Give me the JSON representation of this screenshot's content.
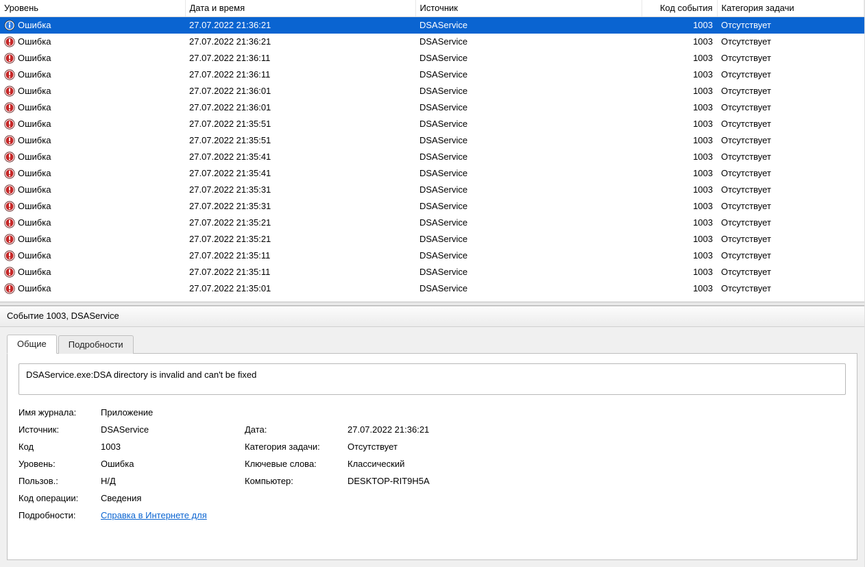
{
  "columns": {
    "level": "Уровень",
    "datetime": "Дата и время",
    "source": "Источник",
    "event_id": "Код события",
    "task_category": "Категория задачи"
  },
  "events": [
    {
      "level": "Ошибка",
      "selected": true,
      "icon": "info",
      "datetime": "27.07.2022 21:36:21",
      "source": "DSAService",
      "id": "1003",
      "category": "Отсутствует"
    },
    {
      "level": "Ошибка",
      "selected": false,
      "icon": "error",
      "datetime": "27.07.2022 21:36:21",
      "source": "DSAService",
      "id": "1003",
      "category": "Отсутствует"
    },
    {
      "level": "Ошибка",
      "selected": false,
      "icon": "error",
      "datetime": "27.07.2022 21:36:11",
      "source": "DSAService",
      "id": "1003",
      "category": "Отсутствует"
    },
    {
      "level": "Ошибка",
      "selected": false,
      "icon": "error",
      "datetime": "27.07.2022 21:36:11",
      "source": "DSAService",
      "id": "1003",
      "category": "Отсутствует"
    },
    {
      "level": "Ошибка",
      "selected": false,
      "icon": "error",
      "datetime": "27.07.2022 21:36:01",
      "source": "DSAService",
      "id": "1003",
      "category": "Отсутствует"
    },
    {
      "level": "Ошибка",
      "selected": false,
      "icon": "error",
      "datetime": "27.07.2022 21:36:01",
      "source": "DSAService",
      "id": "1003",
      "category": "Отсутствует"
    },
    {
      "level": "Ошибка",
      "selected": false,
      "icon": "error",
      "datetime": "27.07.2022 21:35:51",
      "source": "DSAService",
      "id": "1003",
      "category": "Отсутствует"
    },
    {
      "level": "Ошибка",
      "selected": false,
      "icon": "error",
      "datetime": "27.07.2022 21:35:51",
      "source": "DSAService",
      "id": "1003",
      "category": "Отсутствует"
    },
    {
      "level": "Ошибка",
      "selected": false,
      "icon": "error",
      "datetime": "27.07.2022 21:35:41",
      "source": "DSAService",
      "id": "1003",
      "category": "Отсутствует"
    },
    {
      "level": "Ошибка",
      "selected": false,
      "icon": "error",
      "datetime": "27.07.2022 21:35:41",
      "source": "DSAService",
      "id": "1003",
      "category": "Отсутствует"
    },
    {
      "level": "Ошибка",
      "selected": false,
      "icon": "error",
      "datetime": "27.07.2022 21:35:31",
      "source": "DSAService",
      "id": "1003",
      "category": "Отсутствует"
    },
    {
      "level": "Ошибка",
      "selected": false,
      "icon": "error",
      "datetime": "27.07.2022 21:35:31",
      "source": "DSAService",
      "id": "1003",
      "category": "Отсутствует"
    },
    {
      "level": "Ошибка",
      "selected": false,
      "icon": "error",
      "datetime": "27.07.2022 21:35:21",
      "source": "DSAService",
      "id": "1003",
      "category": "Отсутствует"
    },
    {
      "level": "Ошибка",
      "selected": false,
      "icon": "error",
      "datetime": "27.07.2022 21:35:21",
      "source": "DSAService",
      "id": "1003",
      "category": "Отсутствует"
    },
    {
      "level": "Ошибка",
      "selected": false,
      "icon": "error",
      "datetime": "27.07.2022 21:35:11",
      "source": "DSAService",
      "id": "1003",
      "category": "Отсутствует"
    },
    {
      "level": "Ошибка",
      "selected": false,
      "icon": "error",
      "datetime": "27.07.2022 21:35:11",
      "source": "DSAService",
      "id": "1003",
      "category": "Отсутствует"
    },
    {
      "level": "Ошибка",
      "selected": false,
      "icon": "error",
      "datetime": "27.07.2022 21:35:01",
      "source": "DSAService",
      "id": "1003",
      "category": "Отсутствует"
    }
  ],
  "details": {
    "title": "Событие 1003, DSAService",
    "tabs": {
      "general": "Общие",
      "details": "Подробности"
    },
    "message": "DSAService.exe:DSA directory is invalid and can't be fixed",
    "labels": {
      "log_name": "Имя журнала:",
      "source": "Источник:",
      "date": "Дата:",
      "event_id": "Код",
      "task_category": "Категория задачи:",
      "level": "Уровень:",
      "keywords": "Ключевые слова:",
      "user": "Пользов.:",
      "computer": "Компьютер:",
      "opcode": "Код операции:",
      "more_info": "Подробности:"
    },
    "values": {
      "log_name": "Приложение",
      "source": "DSAService",
      "date": "27.07.2022 21:36:21",
      "event_id": "1003",
      "task_category": "Отсутствует",
      "level": "Ошибка",
      "keywords": "Классический",
      "user": "Н/Д",
      "computer": "DESKTOP-RIT9H5A",
      "opcode": "Сведения",
      "help_link": "Справка в Интернете для "
    }
  }
}
